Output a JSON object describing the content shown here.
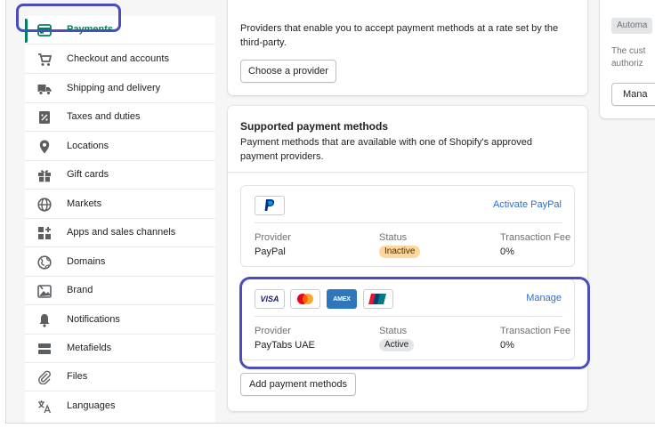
{
  "sidebar": {
    "items": [
      {
        "label": "Payments",
        "icon": "payments-icon",
        "active": true
      },
      {
        "label": "Checkout and accounts",
        "icon": "cart-icon"
      },
      {
        "label": "Shipping and delivery",
        "icon": "truck-icon"
      },
      {
        "label": "Taxes and duties",
        "icon": "tax-icon"
      },
      {
        "label": "Locations",
        "icon": "location-pin-icon"
      },
      {
        "label": "Gift cards",
        "icon": "gift-icon"
      },
      {
        "label": "Markets",
        "icon": "globe-icon"
      },
      {
        "label": "Apps and sales channels",
        "icon": "apps-icon"
      },
      {
        "label": "Domains",
        "icon": "domain-globe-icon"
      },
      {
        "label": "Brand",
        "icon": "brand-icon"
      },
      {
        "label": "Notifications",
        "icon": "bell-icon"
      },
      {
        "label": "Metafields",
        "icon": "metafields-icon"
      },
      {
        "label": "Files",
        "icon": "paperclip-icon"
      },
      {
        "label": "Languages",
        "icon": "translate-icon"
      }
    ]
  },
  "third_party": {
    "description": "Providers that enable you to accept payment methods at a rate set by the third-party.",
    "choose_button": "Choose a provider"
  },
  "supported": {
    "title": "Supported payment methods",
    "description": "Payment methods that are available with one of Shopify's approved payment providers.",
    "paypal": {
      "action": "Activate PayPal",
      "provider_header": "Provider",
      "status_header": "Status",
      "fee_header": "Transaction Fee",
      "provider": "PayPal",
      "status": "Inactive",
      "fee": "0%"
    },
    "paytabs": {
      "action": "Manage",
      "provider_header": "Provider",
      "status_header": "Status",
      "fee_header": "Transaction Fee",
      "provider": "PayTabs UAE",
      "status": "Active",
      "fee": "0%",
      "logos": [
        "VISA",
        "mastercard",
        "AMEX",
        "UnionPay"
      ]
    },
    "add_button": "Add payment methods"
  },
  "right_panel": {
    "tag": "Automa",
    "text_line1": "The cust",
    "text_line2": "authoriz",
    "button": "Mana"
  },
  "colors": {
    "accent": "#008060",
    "highlight": "#4a4dbd",
    "link": "#2c6ecb",
    "inactive_badge": "#ffd79d",
    "paypal_blue": "#003087"
  }
}
